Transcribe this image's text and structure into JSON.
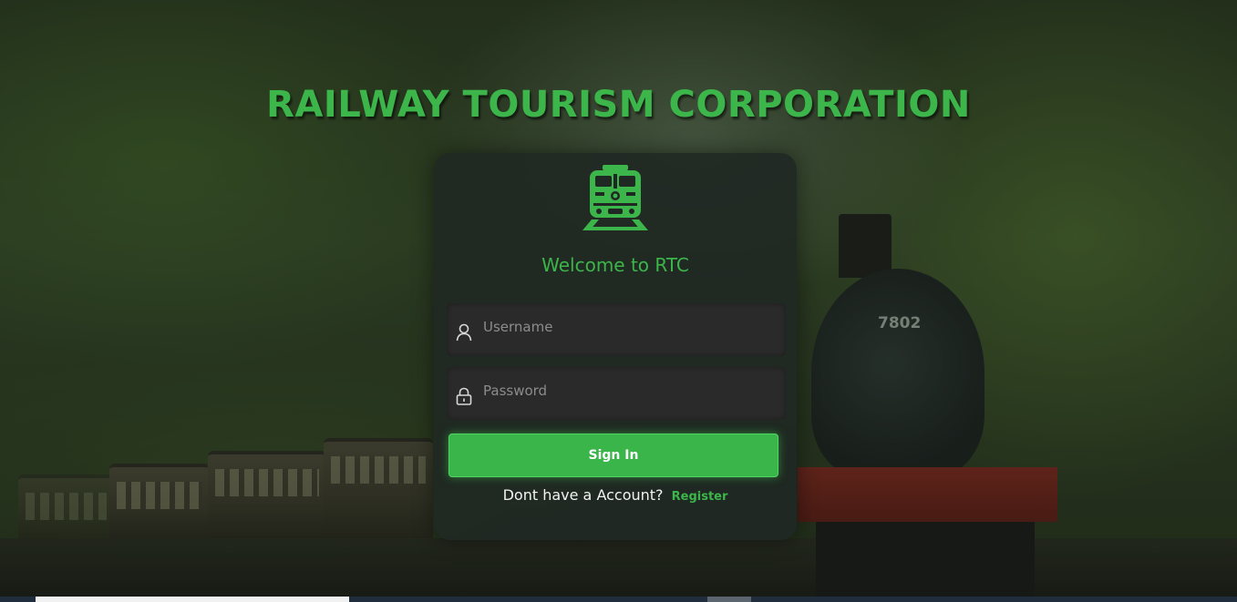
{
  "page": {
    "title": "RAILWAY TOURISM CORPORATION"
  },
  "card": {
    "logo_icon": "train-front-icon",
    "welcome": "Welcome to RTC",
    "username": {
      "placeholder": "Username",
      "value": "",
      "icon": "user-icon"
    },
    "password": {
      "placeholder": "Password",
      "value": "",
      "icon": "lock-icon"
    },
    "signin_label": "Sign In",
    "no_account_text": "Dont have a Account?",
    "register_label": "Register"
  },
  "background": {
    "engine_number": "7802"
  },
  "colors": {
    "accent": "#3cb54a",
    "card_bg": "#202823",
    "field_bg": "#2a2a2a"
  }
}
